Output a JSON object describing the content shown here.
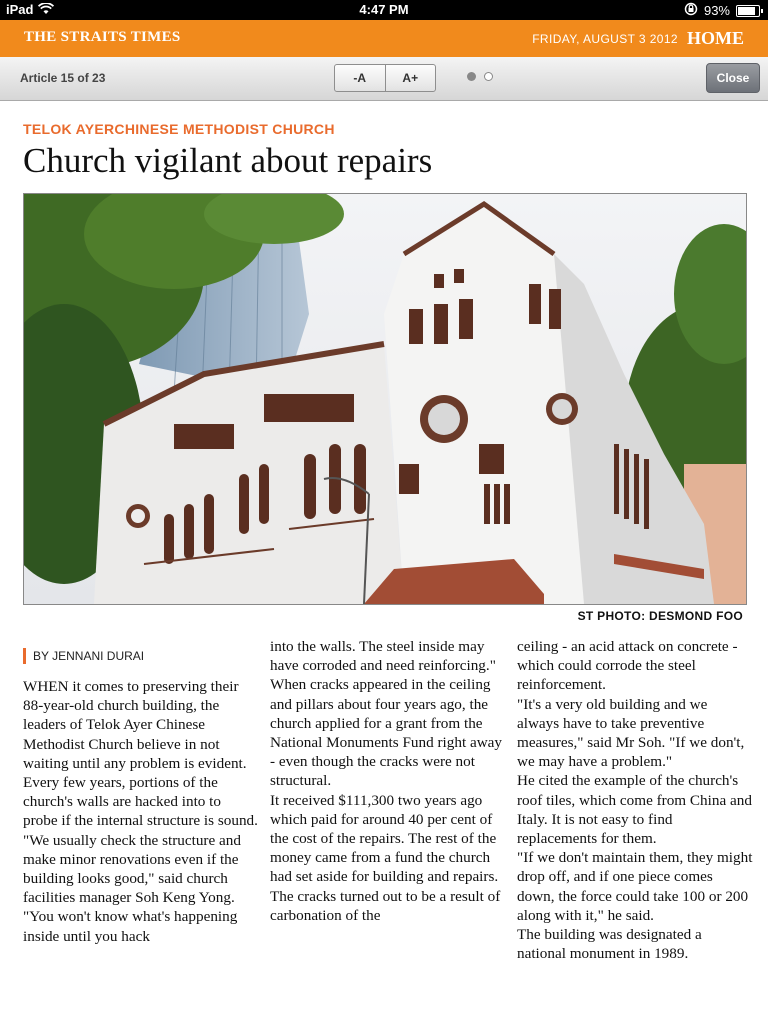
{
  "status_bar": {
    "device": "iPad",
    "time": "4:47 PM",
    "battery": "93%",
    "battery_level": 0.93
  },
  "masthead": {
    "brand": "THE STRAITS TIMES",
    "date": "FRIDAY, AUGUST 3 2012",
    "section": "HOME"
  },
  "toolbar": {
    "article_count": "Article 15 of 23",
    "font_decrease": "-A",
    "font_increase": "A+",
    "close": "Close",
    "page_indicator": {
      "pages": 2,
      "current": 1
    }
  },
  "article": {
    "kicker": "TELOK AYERCHINESE METHODIST CHURCH",
    "headline": "Church vigilant about repairs",
    "photo_credit": "ST PHOTO: DESMOND FOO",
    "byline": "BY JENNANI DURAI",
    "columns": [
      [
        "WHEN it comes to preserving their 88-year-old church building, the leaders of Telok Ayer Chinese Methodist Church believe in not waiting until any problem is evident.",
        " Every few years, portions of the church's walls are hacked into to probe if the internal structure is sound.",
        "\"We usually check the structure and make minor renovations even if the building looks good,\" said church facilities manager Soh Keng Yong.",
        "\"You won't know what's happening inside until you hack"
      ],
      [
        "into the walls. The steel inside may have corroded and need reinforcing.\"",
        " When cracks appeared in the ceiling and pillars about four years ago, the church applied for a grant from the National Monuments Fund right away - even though the cracks were not structural.",
        " It received $111,300 two years ago which paid for around 40 per cent of the cost of the repairs. The rest of the money came from a fund the church had set aside for building and repairs.",
        " The cracks turned out to be a result of carbonation of the"
      ],
      [
        "ceiling - an acid attack on concrete - which could corrode the steel reinforcement.",
        "\"It's a very old building and we always have to take preventive measures,\" said Mr Soh. \"If we don't, we may have a problem.\"",
        " He cited the example of the church's roof tiles, which come from China and Italy. It is not easy to find replacements for them.",
        "\"If we don't maintain them, they might drop off, and if one piece comes down, the force could take 100 or 200 along with it,\" he said.",
        " The building was designated a national monument in 1989."
      ]
    ]
  },
  "colors": {
    "masthead": "#f18a1c",
    "kicker": "#e96b2d"
  }
}
